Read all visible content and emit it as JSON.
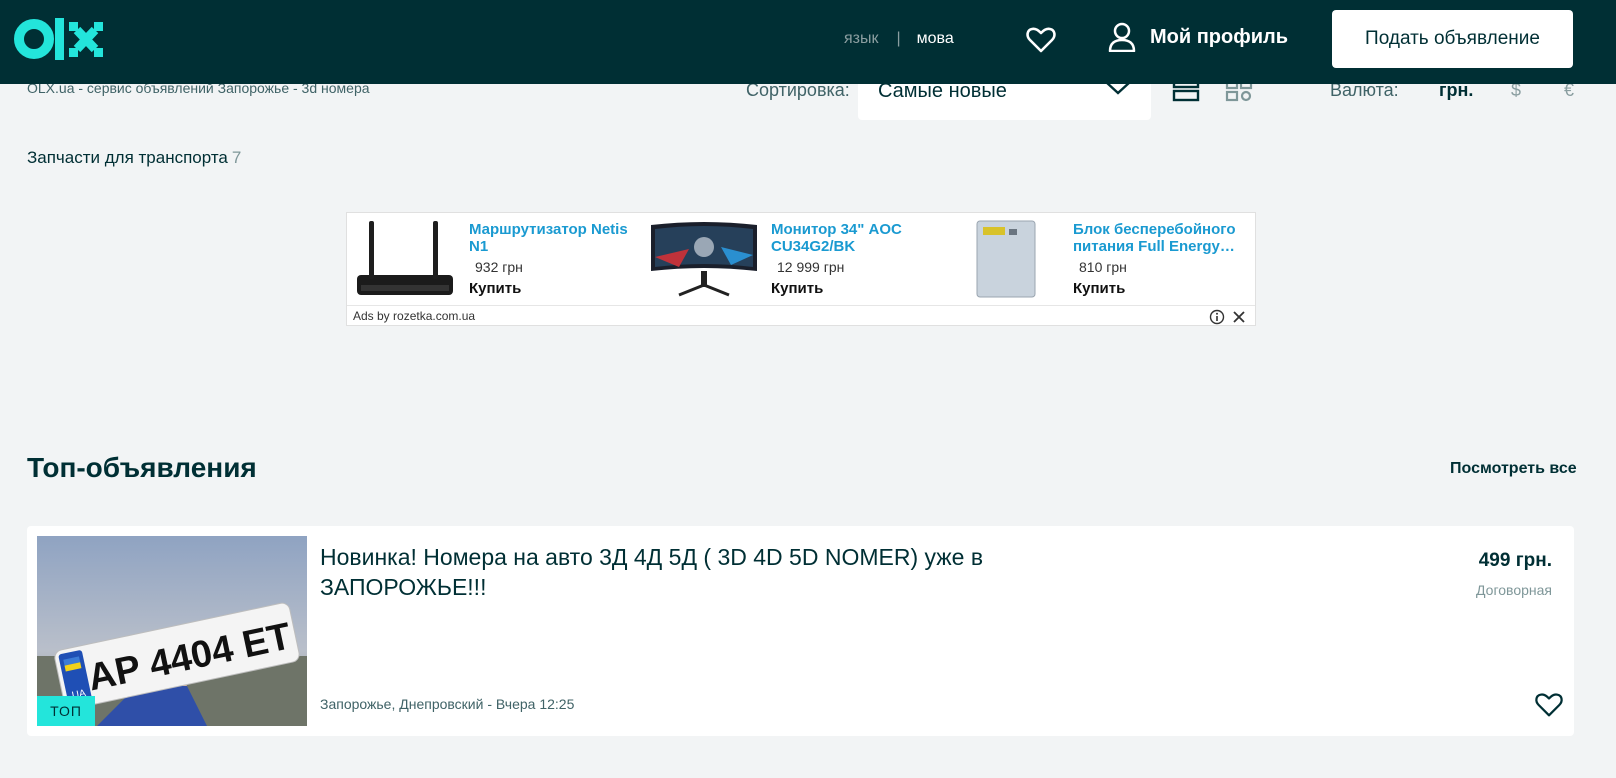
{
  "header": {
    "lang_ru": "язык",
    "lang_sep": "|",
    "lang_ua": "мова",
    "profile_label": "Мой профиль",
    "post_button": "Подать объявление",
    "colors": {
      "bg": "#002f34",
      "logo_accent": "#23e5db"
    }
  },
  "toolbar": {
    "breadcrumb": "OLX.ua - сервис объявлений Запорожье - 3d номера",
    "sort_label": "Сортировка:",
    "sort_value": "Самые новые",
    "currency_label": "Валюта:",
    "currency_uah": "грн.",
    "currency_usd": "$",
    "currency_eur": "€"
  },
  "category": {
    "name": "Запчасти для транспорта",
    "count": "7"
  },
  "ad_block": {
    "items": [
      {
        "title": "Маршрутизатор Netis N1",
        "price": "932 грн",
        "buy": "Купить",
        "icon": "router-image"
      },
      {
        "title": "Монитор 34\" AOC CU34G2/BK",
        "price": "12 999 грн",
        "buy": "Купить",
        "icon": "monitor-image"
      },
      {
        "title": "Блок бесперебойного питания Full Energy…",
        "price": "810 грн",
        "buy": "Купить",
        "icon": "power-unit-image"
      }
    ],
    "ads_by": "Ads by rozetka.com.ua"
  },
  "top_ads": {
    "title": "Топ-объявления",
    "see_all": "Посмотреть все",
    "card": {
      "title": "Новинка! Номера на авто 3Д 4Д 5Д ( 3D 4D 5D NOMER) уже в ЗАПОРОЖЬЕ!!!",
      "price": "499 грн.",
      "negotiable": "Договорная",
      "location": "Запорожье, Днепровский",
      "separator": " - ",
      "time": "Вчера 12:25",
      "badge": "ТОП",
      "plate_text": "AP 4404 ET",
      "plate_country": "UA"
    }
  }
}
